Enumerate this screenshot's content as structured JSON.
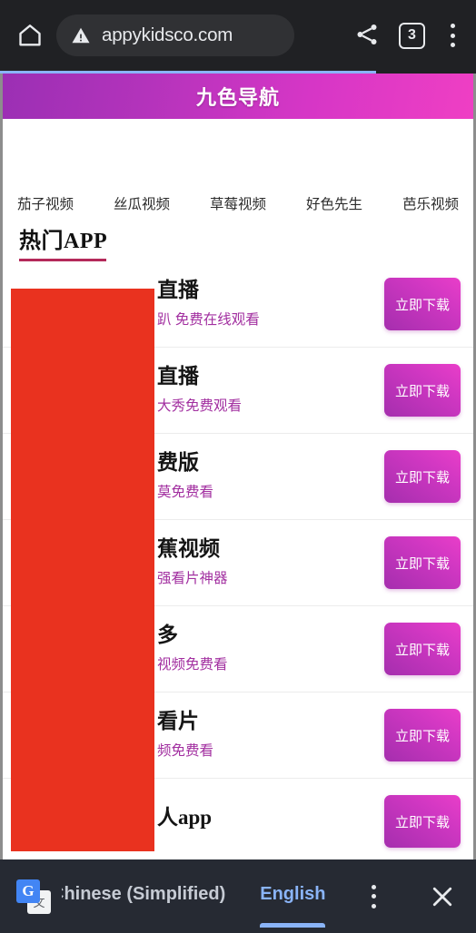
{
  "browser": {
    "home_icon": "home-icon",
    "url": "appykidsco.com",
    "security_icon": "warning-triangle-icon",
    "share_icon": "share-icon",
    "tab_count": "3",
    "menu_icon": "overflow-menu-icon",
    "progress_percent": 79
  },
  "site": {
    "title": "九色导航",
    "nav_links": [
      {
        "label": "茄子视频"
      },
      {
        "label": "丝瓜视频"
      },
      {
        "label": "草莓视频"
      },
      {
        "label": "好色先生"
      },
      {
        "label": "芭乐视频"
      }
    ],
    "section_title": "热门APP",
    "download_label": "立即下载",
    "apps": [
      {
        "name": "直播",
        "desc": "趴 免费在线观看"
      },
      {
        "name": "直播",
        "desc": "大秀免费观看"
      },
      {
        "name": "费版",
        "desc": "莫免费看"
      },
      {
        "name": "蕉视频",
        "desc": "强看片神器"
      },
      {
        "name": "多",
        "desc": "视频免费看"
      },
      {
        "name": "看片",
        "desc": "频免费看"
      },
      {
        "name": "人app",
        "desc": ""
      }
    ]
  },
  "translate_bar": {
    "icon": "google-translate-icon",
    "source_language": "Chinese (Simplified)",
    "target_language": "English",
    "menu_icon": "translate-options-icon",
    "close_icon": "close-icon"
  },
  "colors": {
    "header_gradient_start": "#9b2fb4",
    "header_gradient_end": "#ef3fc4",
    "button_gradient_start": "#e93ec9",
    "button_gradient_end": "#a52eae",
    "desc_text": "#a22fa0",
    "overlay_red": "#e9321f",
    "section_underline": "#b4295a",
    "progress_blue": "#8ab4f8",
    "translate_accent": "#8ab4f8",
    "chrome_background": "#202124",
    "translate_background": "#262a33"
  }
}
